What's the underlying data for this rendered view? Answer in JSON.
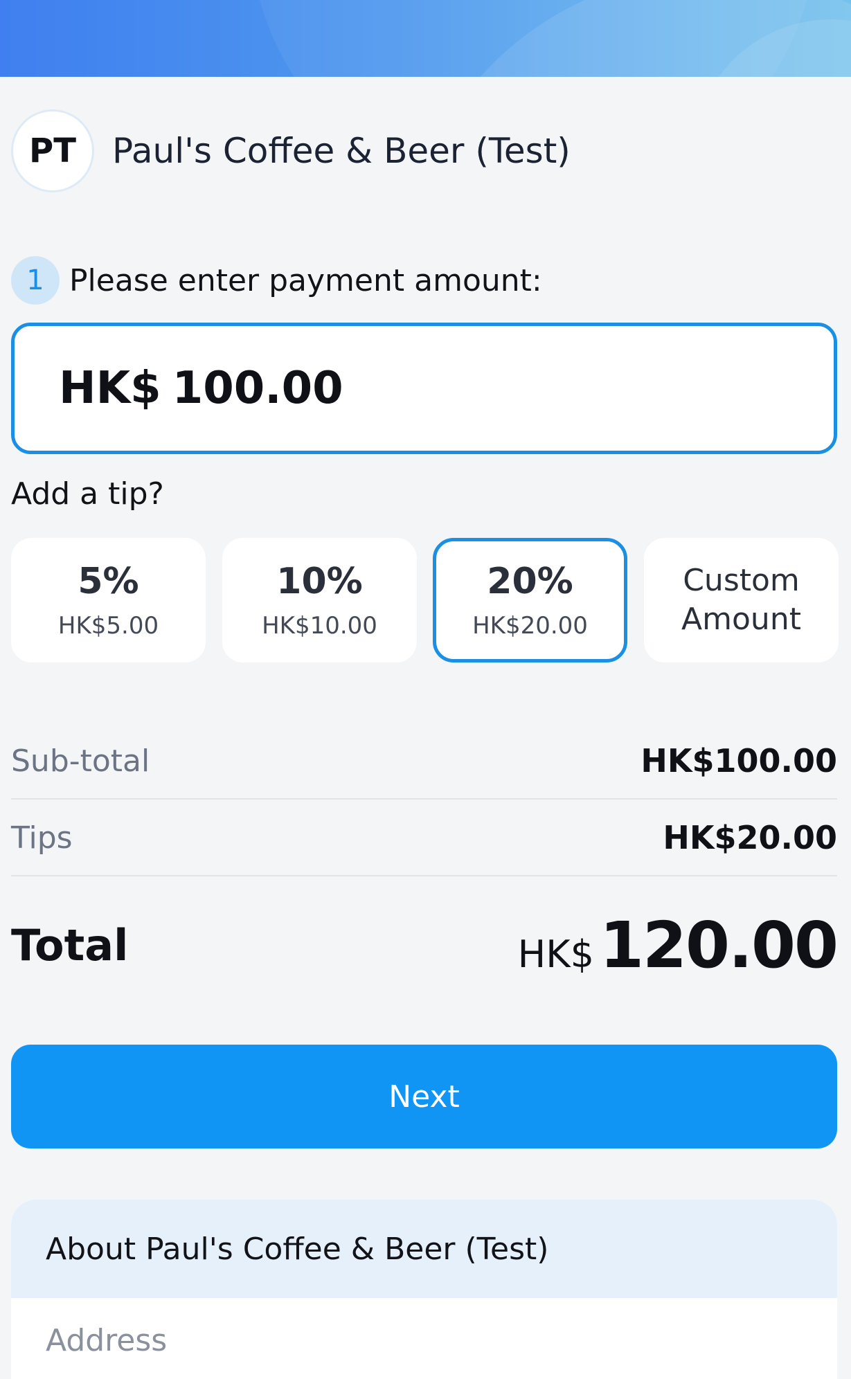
{
  "merchant": {
    "initials": "PT",
    "name": "Paul's Coffee & Beer (Test)"
  },
  "step": {
    "number": "1",
    "label": "Please enter payment amount:"
  },
  "amount_input": {
    "currency": "HK$",
    "value": "100.00"
  },
  "tip": {
    "heading": "Add a tip?",
    "options": [
      {
        "percent": "5%",
        "amount": "HK$5.00",
        "selected": false
      },
      {
        "percent": "10%",
        "amount": "HK$10.00",
        "selected": false
      },
      {
        "percent": "20%",
        "amount": "HK$20.00",
        "selected": true
      }
    ],
    "custom_line1": "Custom",
    "custom_line2": "Amount"
  },
  "summary": {
    "subtotal_label": "Sub-total",
    "subtotal_value": "HK$100.00",
    "tips_label": "Tips",
    "tips_value": "HK$20.00",
    "total_label": "Total",
    "total_currency": "HK$",
    "total_value": "120.00"
  },
  "actions": {
    "next_label": "Next"
  },
  "about": {
    "title": "About Paul's Coffee & Beer (Test)",
    "address_label": "Address"
  },
  "colors": {
    "accent": "#1195f5",
    "selected_border": "#1a8fe3",
    "background": "#f4f5f6"
  }
}
